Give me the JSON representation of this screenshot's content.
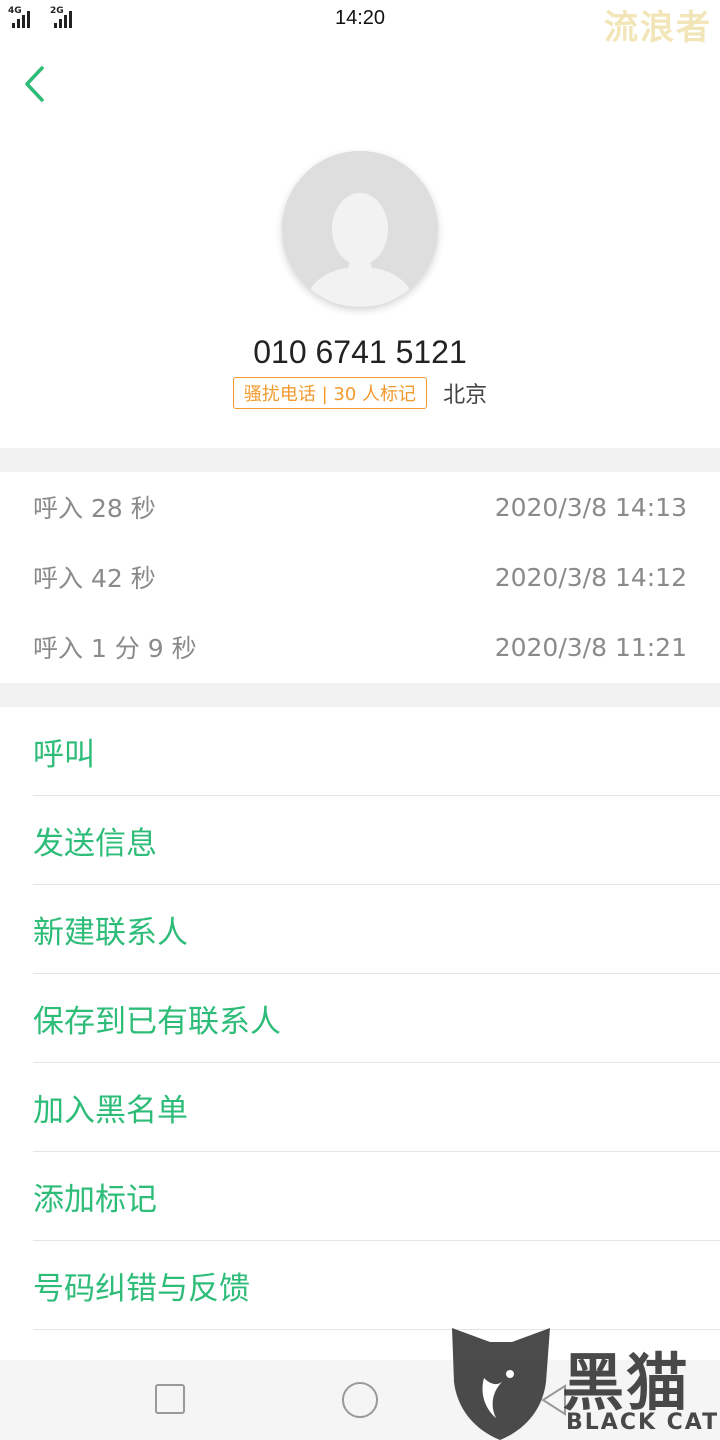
{
  "status_bar": {
    "sim1_label": "4G",
    "sim2_label": "2G",
    "time": "14:20",
    "watermark": "流浪者"
  },
  "contact": {
    "number": "010 6741 5121",
    "spam_tag": "骚扰电话 | 30 人标记",
    "region": "北京"
  },
  "call_log": [
    {
      "type_duration": "呼入  28 秒",
      "datetime": "2020/3/8 14:13"
    },
    {
      "type_duration": "呼入  42 秒",
      "datetime": "2020/3/8 14:12"
    },
    {
      "type_duration": "呼入  1 分 9 秒",
      "datetime": "2020/3/8 11:21"
    }
  ],
  "actions": [
    {
      "label": "呼叫"
    },
    {
      "label": "发送信息"
    },
    {
      "label": "新建联系人"
    },
    {
      "label": "保存到已有联系人"
    },
    {
      "label": "加入黑名单"
    },
    {
      "label": "添加标记"
    },
    {
      "label": "号码纠错与反馈"
    }
  ],
  "branding": {
    "logo_cn": "黑猫",
    "logo_en": "BLACK CAT"
  },
  "colors": {
    "accent": "#2ebc79",
    "spam": "#f29a2e"
  },
  "icons": {
    "back": "chevron-left-icon",
    "avatar": "default-avatar-icon",
    "nav_recent": "square-icon",
    "nav_home": "circle-icon",
    "nav_back": "triangle-back-icon"
  }
}
